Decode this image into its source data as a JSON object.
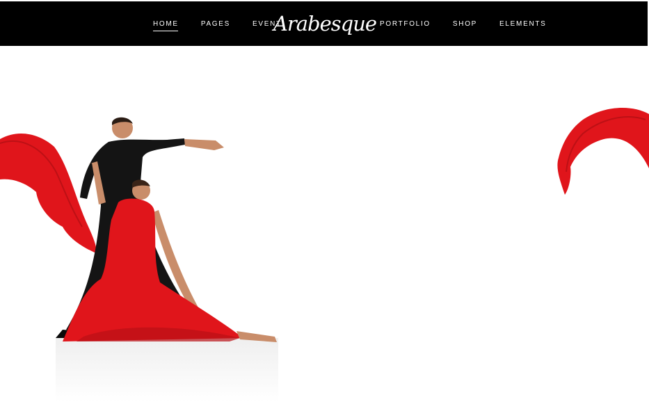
{
  "header": {
    "logo_text": "Arabesque",
    "nav_left": [
      "HOME",
      "PAGES",
      "EVENT"
    ],
    "nav_right": [
      "PORTFOLIO",
      "SHOP",
      "ELEMENTS"
    ],
    "active_item": "HOME"
  },
  "colors": {
    "header_bg": "#000000",
    "accent_red": "#e0151b",
    "background": "#ffffff"
  }
}
